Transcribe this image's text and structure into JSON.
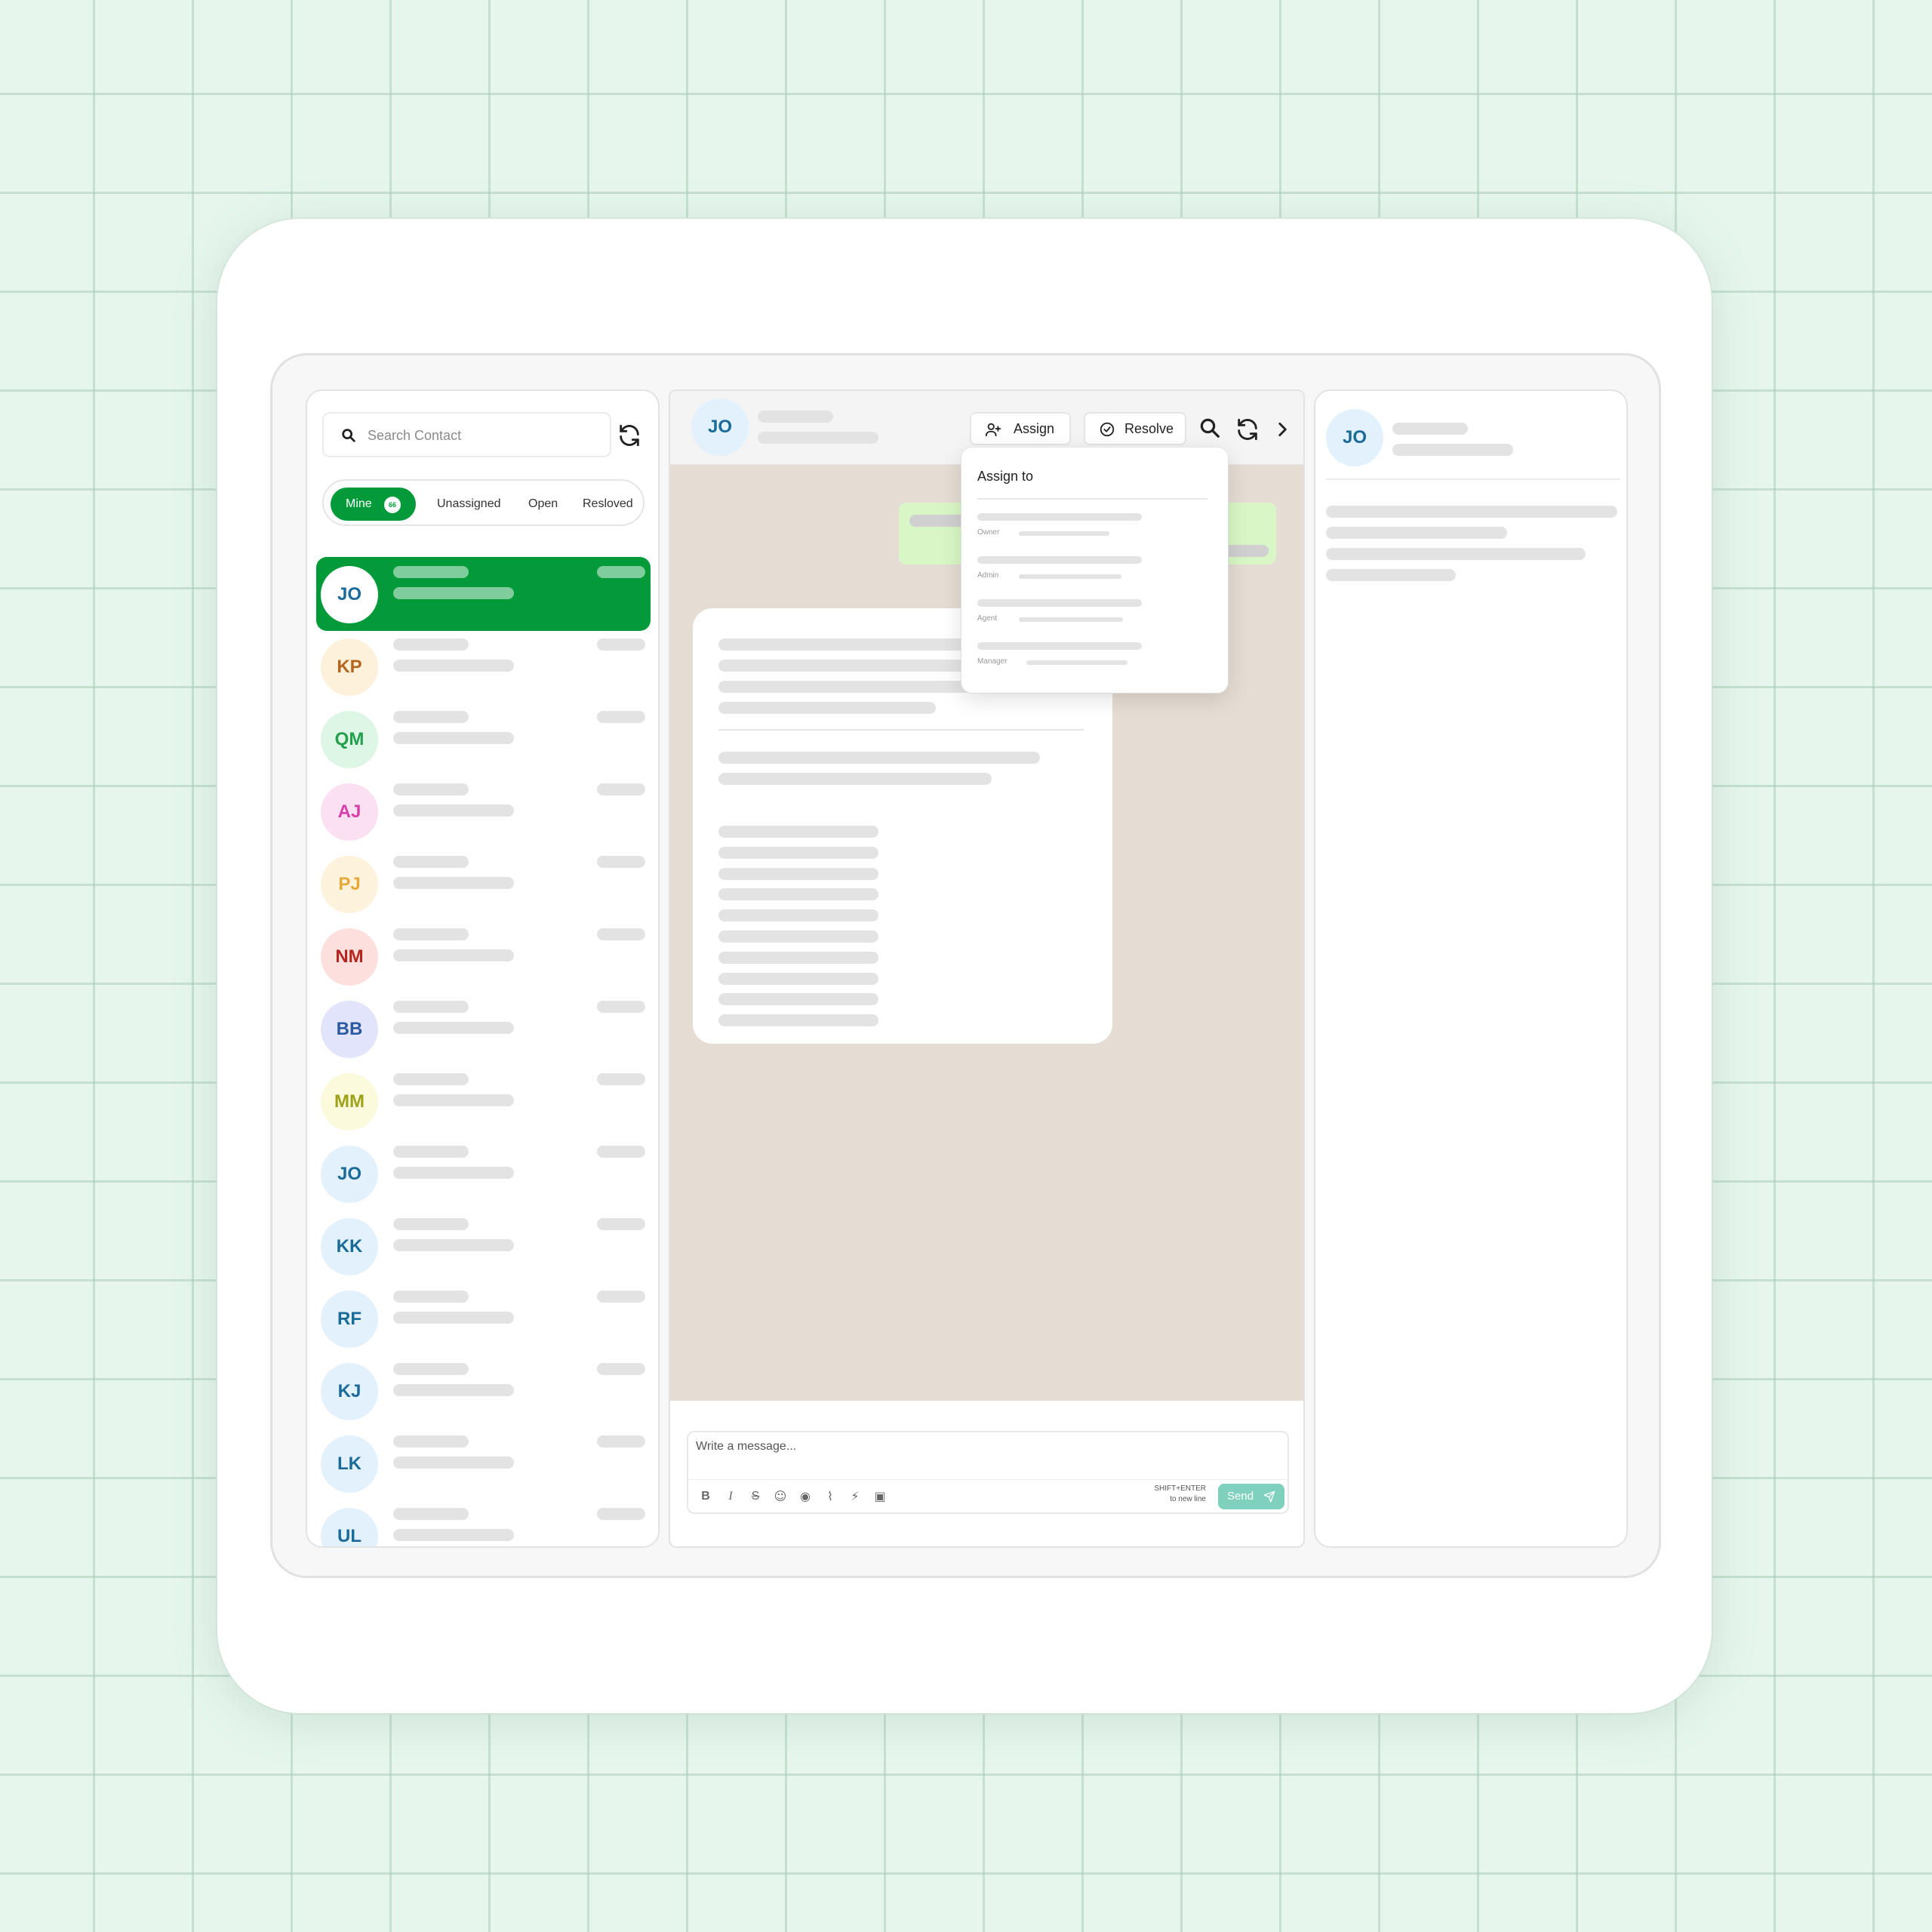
{
  "colors": {
    "accent": "#039b3a",
    "send": "#7fd1bd",
    "chat_bg": "#e5ddd4"
  },
  "sidebar": {
    "search_placeholder": "Search Contact",
    "filters": [
      {
        "label": "Mine",
        "badge": "66"
      },
      {
        "label": "Unassigned"
      },
      {
        "label": "Open"
      },
      {
        "label": "Resloved"
      }
    ],
    "contacts": [
      {
        "initials": "JO",
        "bg": "#ffffff",
        "fg": "#1a6b9a"
      },
      {
        "initials": "KP",
        "bg": "#fdf1dc",
        "fg": "#b5651d"
      },
      {
        "initials": "QM",
        "bg": "#ddf6e6",
        "fg": "#22a04b"
      },
      {
        "initials": "AJ",
        "bg": "#fbe0f1",
        "fg": "#d63fa8"
      },
      {
        "initials": "PJ",
        "bg": "#fdf2dc",
        "fg": "#e6a93a"
      },
      {
        "initials": "NM",
        "bg": "#fde0de",
        "fg": "#b3261e"
      },
      {
        "initials": "BB",
        "bg": "#e2e4fb",
        "fg": "#2c5aa0"
      },
      {
        "initials": "MM",
        "bg": "#fbfadc",
        "fg": "#9ea21a"
      },
      {
        "initials": "JO",
        "bg": "#e2f1fb",
        "fg": "#1a6b9a"
      },
      {
        "initials": "KK",
        "bg": "#e2f1fb",
        "fg": "#1a6b9a"
      },
      {
        "initials": "RF",
        "bg": "#e2f1fb",
        "fg": "#1a6b9a"
      },
      {
        "initials": "KJ",
        "bg": "#e2f1fb",
        "fg": "#1a6b9a"
      },
      {
        "initials": "LK",
        "bg": "#e2f1fb",
        "fg": "#1a6b9a"
      },
      {
        "initials": "UL",
        "bg": "#e2f1fb",
        "fg": "#1a6b9a"
      }
    ]
  },
  "chat": {
    "contact_initials": "JO",
    "assign_label": "Assign",
    "resolve_label": "Resolve",
    "composer_placeholder": "Write a message...",
    "hint_line1": "SHIFT+ENTER",
    "hint_line2": "to new line",
    "send_label": "Send",
    "tools": [
      "bold-icon",
      "italic-icon",
      "strikethrough-icon",
      "emoji-icon",
      "eye-icon",
      "attachment-icon",
      "lightning-icon",
      "quick-reply-icon"
    ]
  },
  "assign_menu": {
    "title": "Assign to",
    "roles": [
      "Owner",
      "Admin",
      "Agent",
      "Manager"
    ]
  },
  "details": {
    "contact_initials": "JO"
  }
}
